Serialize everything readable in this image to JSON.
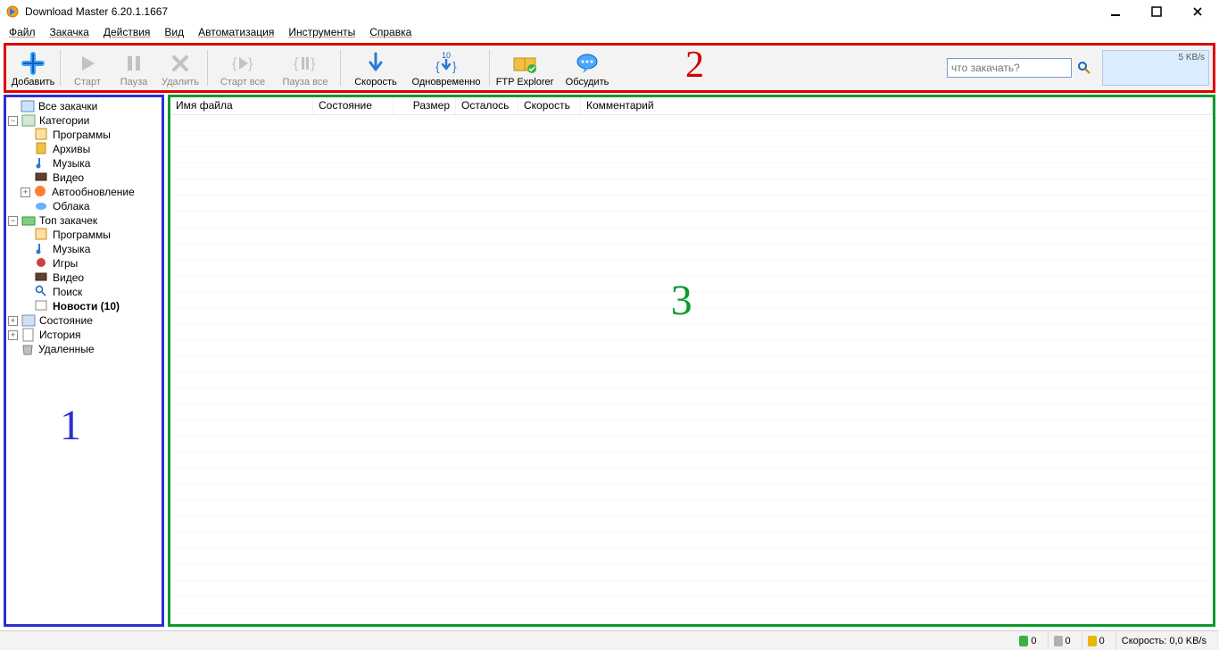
{
  "window": {
    "title": "Download Master 6.20.1.1667"
  },
  "menu": [
    "Файл",
    "Закачка",
    "Действия",
    "Вид",
    "Автоматизация",
    "Инструменты",
    "Справка"
  ],
  "toolbar": {
    "add": "Добавить",
    "start": "Старт",
    "pause": "Пауза",
    "delete": "Удалить",
    "start_all": "Старт все",
    "pause_all": "Пауза все",
    "speed": "Скорость",
    "concurrent": "Одновременно",
    "concurrent_count": "10",
    "ftp": "FTP Explorer",
    "discuss": "Обсудить",
    "search_placeholder": "что закачать?",
    "speed_box": "5 KB/s"
  },
  "annotations": {
    "one": "1",
    "two": "2",
    "three": "3"
  },
  "tree": {
    "all": "Все закачки",
    "categories": "Категории",
    "cat_items": [
      "Программы",
      "Архивы",
      "Музыка",
      "Видео",
      "Автообновление",
      "Облака"
    ],
    "top": "Топ закачек",
    "top_items": [
      "Программы",
      "Музыка",
      "Игры",
      "Видео",
      "Поиск"
    ],
    "news": "Новости (10)",
    "state": "Состояние",
    "history": "История",
    "deleted": "Удаленные"
  },
  "columns": [
    "Имя файла",
    "Состояние",
    "Размер",
    "Осталось",
    "Скорость",
    "Комментарий"
  ],
  "status": {
    "active": "0",
    "queued": "0",
    "paused": "0",
    "speed": "Скорость: 0,0 KB/s"
  }
}
